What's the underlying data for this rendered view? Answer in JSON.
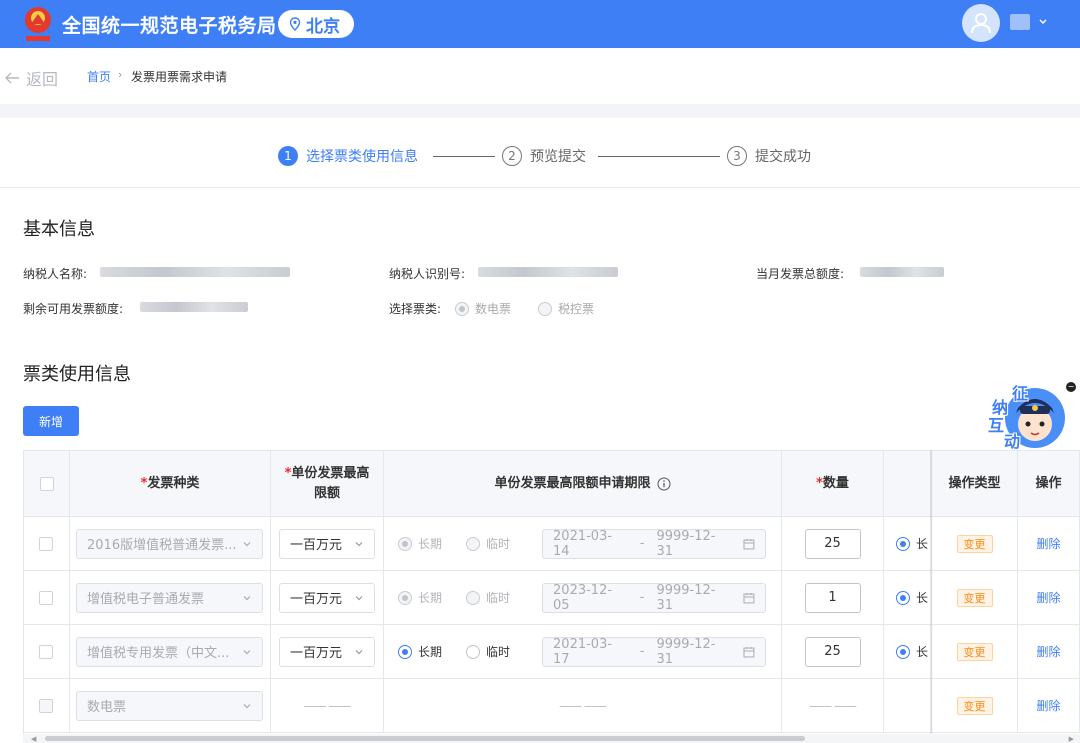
{
  "header": {
    "app_title": "全国统一规范电子税务局",
    "region": "北京",
    "colors": {
      "brand": "#3e7ff5",
      "required": "#f5222d",
      "tag_orange": "#fa8c16"
    }
  },
  "breadcrumb": {
    "back_label": "返回",
    "home": "首页",
    "separator": "›",
    "current": "发票用票需求申请"
  },
  "steps": [
    {
      "num": "1",
      "label": "选择票类使用信息",
      "state": "active"
    },
    {
      "num": "2",
      "label": "预览提交",
      "state": "todo"
    },
    {
      "num": "3",
      "label": "提交成功",
      "state": "todo"
    }
  ],
  "basic_info": {
    "title": "基本信息",
    "taxpayer_name_label": "纳税人名称:",
    "taxpayer_id_label": "纳税人识别号:",
    "monthly_total_label": "当月发票总额度:",
    "remaining_label": "剩余可用发票额度:",
    "ticket_type_label": "选择票类:",
    "ticket_type_options": [
      "数电票",
      "税控票"
    ],
    "ticket_type_selected": "数电票"
  },
  "usage_info": {
    "title": "票类使用信息",
    "add_button": "新增"
  },
  "mascot": {
    "chars": [
      "征",
      "纳",
      "互",
      "动"
    ]
  },
  "table": {
    "headers": {
      "invoice_type": "发票种类",
      "max_amount_line1": "单份发票最高",
      "max_amount_line2": "限额",
      "period": "单份发票最高限额申请期限",
      "quantity": "数量",
      "op_type": "操作类型",
      "op": "操作",
      "required_mark": "*"
    },
    "period_options": {
      "long": "长期",
      "temp": "临时"
    },
    "truncated_radio_label": "长",
    "rows": [
      {
        "invoice_type": "2016版增值税普通发票...",
        "max_amount": "一百万元",
        "start": "2021-03-14",
        "end": "9999-12-31",
        "quantity": "25",
        "op_type": "变更",
        "op": "删除",
        "editable": false
      },
      {
        "invoice_type": "增值税电子普通发票",
        "max_amount": "一百万元",
        "start": "2023-12-05",
        "end": "9999-12-31",
        "quantity": "1",
        "op_type": "变更",
        "op": "删除",
        "editable": false
      },
      {
        "invoice_type": "增值税专用发票（中文...",
        "max_amount": "一百万元",
        "start": "2021-03-17",
        "end": "9999-12-31",
        "quantity": "25",
        "op_type": "变更",
        "op": "删除",
        "editable": true
      },
      {
        "invoice_type": "数电票",
        "max_amount": "",
        "start": "",
        "end": "",
        "quantity": "",
        "op_type": "变更",
        "op": "删除",
        "editable": false
      }
    ],
    "date_separator": "-"
  }
}
